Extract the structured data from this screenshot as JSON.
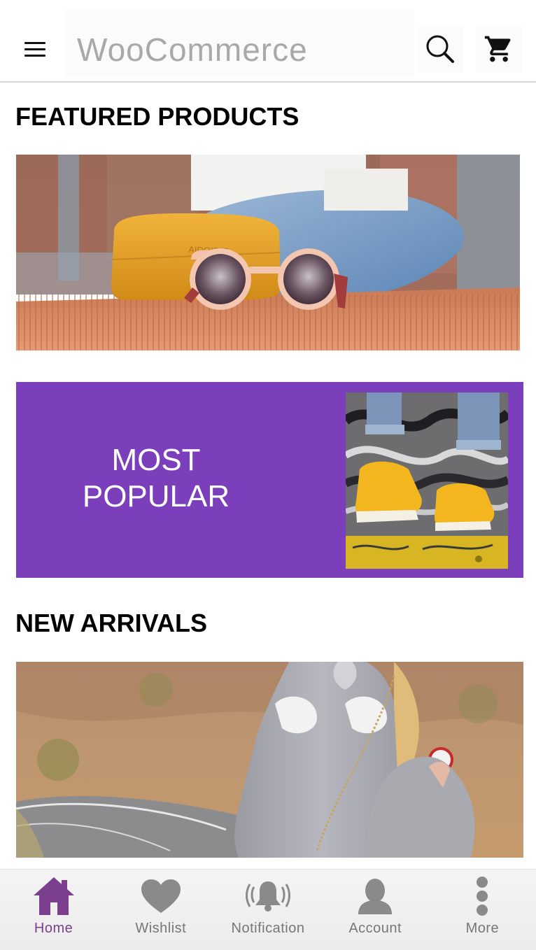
{
  "header": {
    "title": "WooCommerce",
    "menu_icon": "hamburger-menu-icon",
    "search_icon": "search-icon",
    "cart_icon": "shopping-cart-icon"
  },
  "sections": {
    "featured_title": "FEATURED PRODUCTS",
    "popular_line1": "MOST",
    "popular_line2": "POPULAR",
    "arrivals_title": "NEW ARRIVALS"
  },
  "images": {
    "case_text": "AIDOIRIE"
  },
  "colors": {
    "accent": "#7b3fbb",
    "active_nav": "#7b3f8e",
    "inactive_nav": "#777777"
  },
  "bottom_nav": {
    "items": [
      {
        "label": "Home",
        "icon": "home-icon",
        "active": true
      },
      {
        "label": "Wishlist",
        "icon": "heart-icon",
        "active": false
      },
      {
        "label": "Notification",
        "icon": "bell-icon",
        "active": false
      },
      {
        "label": "Account",
        "icon": "user-icon",
        "active": false
      },
      {
        "label": "More",
        "icon": "more-vertical-icon",
        "active": false
      }
    ]
  }
}
